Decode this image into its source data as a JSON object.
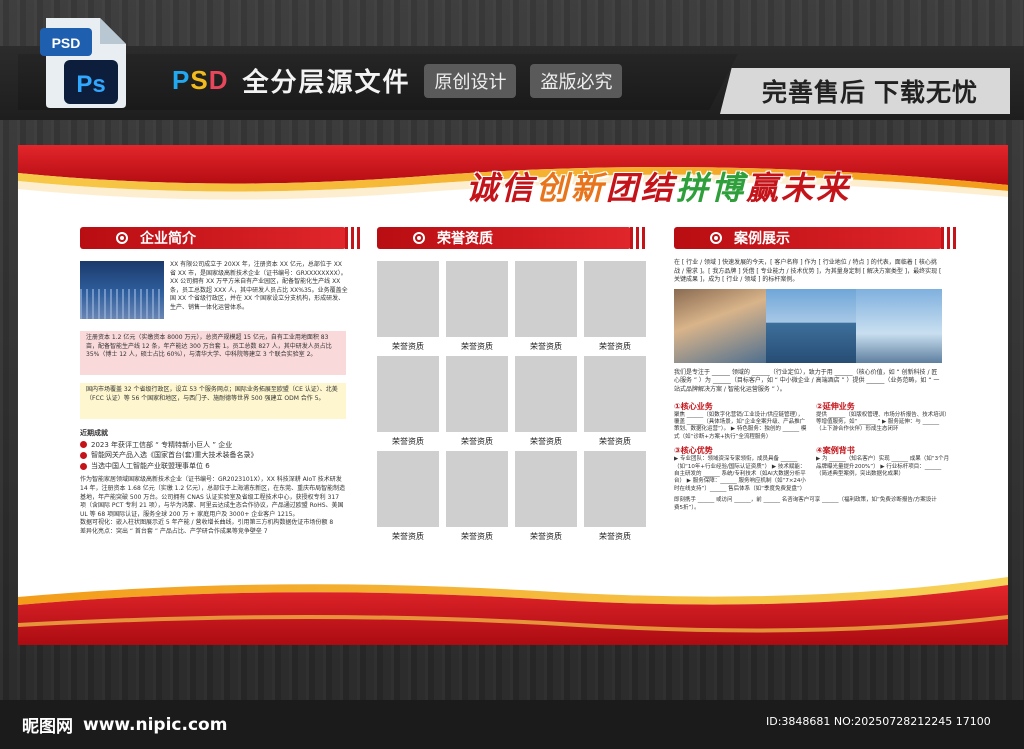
{
  "header": {
    "psd_label": "PSD",
    "psd_word": {
      "p": "P",
      "s": "S",
      "d": "D"
    },
    "subtitle": "全分层源文件",
    "pill_original": "原创设计",
    "pill_piracy": "盗版必究",
    "right_slogan": "完善售后 下载无忧",
    "icon_psd": "PSD",
    "icon_ps": "Ps"
  },
  "board": {
    "slogan": {
      "a": "诚信",
      "b": "创新",
      "c": "团结",
      "d": "拼博",
      "e": "赢未来"
    },
    "company": {
      "title": "企业简介",
      "p1": "XX 有限公司成立于 20XX 年，注册资本 XX 亿元，总部位于 XX 省 XX 市，是国家级高新技术企业（证书编号：GRXXXXXXXX）。XX 公司拥有 XX 万平方米自有产业园区，配备智能化生产线 XX 条，员工总数超 XXX 人，其中研发人员占比 XX%35。业务覆盖全国 XX 个省级行政区，并在 XX 个国家设立分支机构，形成研发、生产、销售一体化运营体系。",
      "p2": "注册资本 1.2 亿元（实缴资本 8000 万元），总资产规模超 15 亿元，自有工业用地面积 83 亩，配备智能生产线 12 条，年产能达 300 万台套 1。员工总数 827 人，其中研发人员占比 35%（博士 12 人，硕士占比 60%），与清华大学、中科院等建立 3 个联合实验室 2。",
      "p3": "国内市场覆盖 32 个省级行政区，设立 53 个服务网点；国际业务拓展至欧盟（CE 认证）、北美（FCC 认证）等 56 个国家和地区，与西门子、施耐德等世界 500 强建立 ODM 合作 5。",
      "achieve_title": "近期成就",
      "achievements": [
        "2023 年获评工信部 “ 专精特新小巨人 ” 企业",
        "智能网关产品入选《国家首台(套)重大技术装备名录》",
        "当选中国人工智能产业联盟理事单位 6"
      ],
      "p4": "作为智能家居领域国家级高新技术企业（证书编号：GR2023101X），XX 科技深耕 AIoT 技术研发 14 年，注册资本 1.68 亿元（实缴 1.2 亿元），总部位于上海浦东新区，在东莞、重庆布局智能制造基地，年产能突破 500 万台。公司拥有 CNAS 认证实验室及省级工程技术中心，获授权专利 317 项（含国际 PCT 专利 21 项），与华为鸿蒙、阿里云达成生态合作协议，产品通过欧盟 RoHS、美国 UL 等 68 项国际认证，服务全球 200 万 + 家庭用户及 3000+ 企业客户 1215。",
      "p5": "数据可视化：嵌入柱状图展示近 5 年产能 / 营收增长曲线，引用第三方机构数据佐证市场份额 8",
      "p6": "差异化亮点：突出 “ 首台套 ” 产品占比、产学研合作成果等竞争壁垒 7"
    },
    "honor": {
      "title": "荣誉资质",
      "items": [
        "荣誉资质",
        "荣誉资质",
        "荣誉资质",
        "荣誉资质",
        "荣誉资质",
        "荣誉资质",
        "荣誉资质",
        "荣誉资质",
        "荣誉资质",
        "荣誉资质",
        "荣誉资质",
        "荣誉资质"
      ]
    },
    "cases": {
      "title": "案例展示",
      "p1": "在 [ 行业 / 领域 ] 快速发展的今天，[ 客户名称 ] 作为 [ 行业地位 / 特点 ] 的代表，面临着 [ 核心挑战 / 需求 ]。[ 我方品牌 ] 凭借 [ 专业能力 / 技术优势 ]，为其量身定制 [ 解决方案类型 ]，最终实现 [ 关键成果 ]，成为 [ 行业 / 领域 ] 的标杆案例。",
      "p2": "我们是专注于 ______ 领域的 ______（行业定位），致力于用 ______（核心价值，如 “ 创新科技 / 匠心服务 ” ）为 ______（目标客户，如 “ 中小微企业 / 高端酒店 ” ）提供 ______（业务范畴，如 “ 一站式品牌解决方案 / 智能化运营服务 ” ）。",
      "s1_title": "①核心业务",
      "s1_text": "聚焦 ______（如数字化营销/工业设计/供应链管理），覆盖 ______（具体场景，如“企业全案升级、产品推广策划、数据化运营”）。 ▶ 特色服务：独创的 ______ 模式（如“诊断+方案+执行”全流程服务）",
      "s2_title": "②延伸业务",
      "s2_text": "提供 ______（如版权管理、市场分析报告、技术培训）等增值服务，如“ ______ ” ▶ 服务延伸：与 ______（上下游合作伙伴）形成生态闭环",
      "s3_title": "③核心优势",
      "s3_text": "▶ 专业团队：领域资深专家领衔，成员具备 ______（如“10年+行业经验/国际认证资质”） ▶ 技术赋能：自主研发的 ______ 系统/专利技术（如AI大数据分析平台） ▶ 服务保障：______ 服务响应机制（如“7×24小时在线支持”）______ 售后体系（如“季度免费复盘”）",
      "s4_title": "④案例背书",
      "s4_text": "▶ 为 ______（知名客户）实现 ______ 成果（如“3个月品牌曝光量提升200%”） ▶ 行业标杆项目：______（简述典型案例，突出数据化成果）",
      "p3": "即刻携手 ______ 或访问 ______，前 ______ 名咨询客户可享 ______（福利政策，如“免费诊断报告/方案设计费5折”）。"
    }
  },
  "footer": {
    "site_name": "昵图网",
    "url": "www.nipic.com",
    "id_text": "ID:3848681 NO:20250728212245 17100"
  },
  "colors": {
    "brand_red": "#c4141a",
    "accent_green": "#2e9f3a",
    "accent_orange": "#e8741c",
    "ps_blue": "#21a8f0"
  }
}
